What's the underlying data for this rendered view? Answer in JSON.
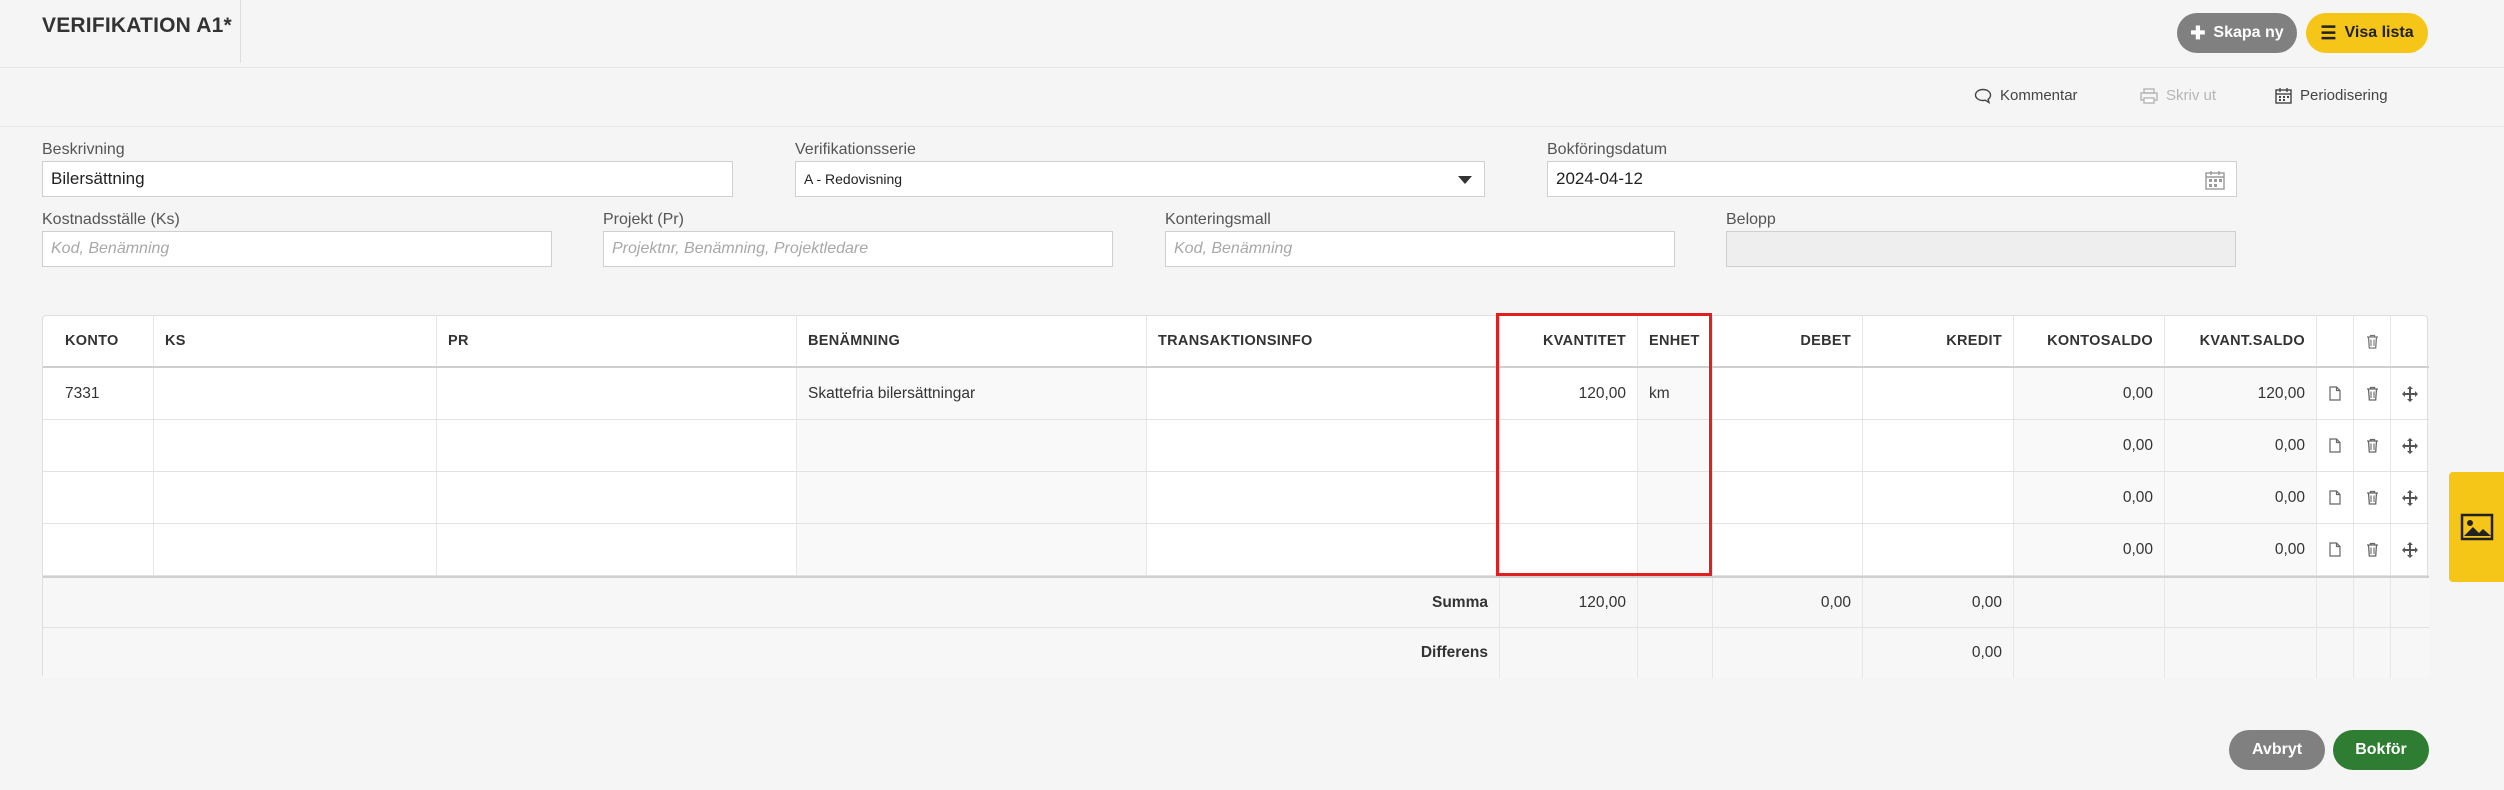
{
  "header": {
    "title": "VERIFIKATION A1*",
    "create_label": "Skapa ny",
    "list_label": "Visa lista"
  },
  "actions": {
    "comment_label": "Kommentar",
    "print_label": "Skriv ut",
    "period_label": "Periodisering"
  },
  "form": {
    "description": {
      "label": "Beskrivning",
      "value": "Bilersättning"
    },
    "series": {
      "label": "Verifikationsserie",
      "value": "A - Redovisning"
    },
    "date": {
      "label": "Bokföringsdatum",
      "value": "2024-04-12"
    },
    "cost_center": {
      "label": "Kostnadsställe (Ks)",
      "placeholder": "Kod, Benämning"
    },
    "project": {
      "label": "Projekt (Pr)",
      "placeholder": "Projektnr, Benämning, Projektledare"
    },
    "template": {
      "label": "Konteringsmall",
      "placeholder": "Kod, Benämning"
    },
    "amount": {
      "label": "Belopp",
      "value": ""
    }
  },
  "table": {
    "headers": {
      "konto": "KONTO",
      "ks": "KS",
      "pr": "PR",
      "benamning": "BENÄMNING",
      "transinfo": "TRANSAKTIONSINFO",
      "kvantitet": "KVANTITET",
      "enhet": "ENHET",
      "debet": "DEBET",
      "kredit": "KREDIT",
      "kontosaldo": "KONTOSALDO",
      "kvantsaldo": "KVANT.SALDO"
    },
    "rows": [
      {
        "konto": "7331",
        "ks": "",
        "pr": "",
        "benamning": "Skattefria bilersättningar",
        "transinfo": "",
        "kvantitet": "120,00",
        "enhet": "km",
        "debet": "",
        "kredit": "",
        "kontosaldo": "0,00",
        "kvantsaldo": "120,00"
      },
      {
        "konto": "",
        "ks": "",
        "pr": "",
        "benamning": "",
        "transinfo": "",
        "kvantitet": "",
        "enhet": "",
        "debet": "",
        "kredit": "",
        "kontosaldo": "0,00",
        "kvantsaldo": "0,00"
      },
      {
        "konto": "",
        "ks": "",
        "pr": "",
        "benamning": "",
        "transinfo": "",
        "kvantitet": "",
        "enhet": "",
        "debet": "",
        "kredit": "",
        "kontosaldo": "0,00",
        "kvantsaldo": "0,00"
      },
      {
        "konto": "",
        "ks": "",
        "pr": "",
        "benamning": "",
        "transinfo": "",
        "kvantitet": "",
        "enhet": "",
        "debet": "",
        "kredit": "",
        "kontosaldo": "0,00",
        "kvantsaldo": "0,00"
      }
    ],
    "summa": {
      "label": "Summa",
      "kvantitet": "120,00",
      "debet": "0,00",
      "kredit": "0,00"
    },
    "differens": {
      "label": "Differens",
      "kredit": "0,00"
    }
  },
  "footer": {
    "cancel_label": "Avbryt",
    "book_label": "Bokför"
  },
  "colors": {
    "accent_yellow": "#f5c518",
    "button_gray": "#808080",
    "book_green": "#2e7d32",
    "highlight_red": "#e02020"
  },
  "icons": {
    "create": "plus-icon",
    "list": "list-icon",
    "comment": "speech-bubble-icon",
    "print": "printer-icon",
    "period": "calendar-icon",
    "row_doc": "document-icon",
    "row_delete": "trash-icon",
    "row_move": "move-icon",
    "side_tab": "image-icon"
  }
}
